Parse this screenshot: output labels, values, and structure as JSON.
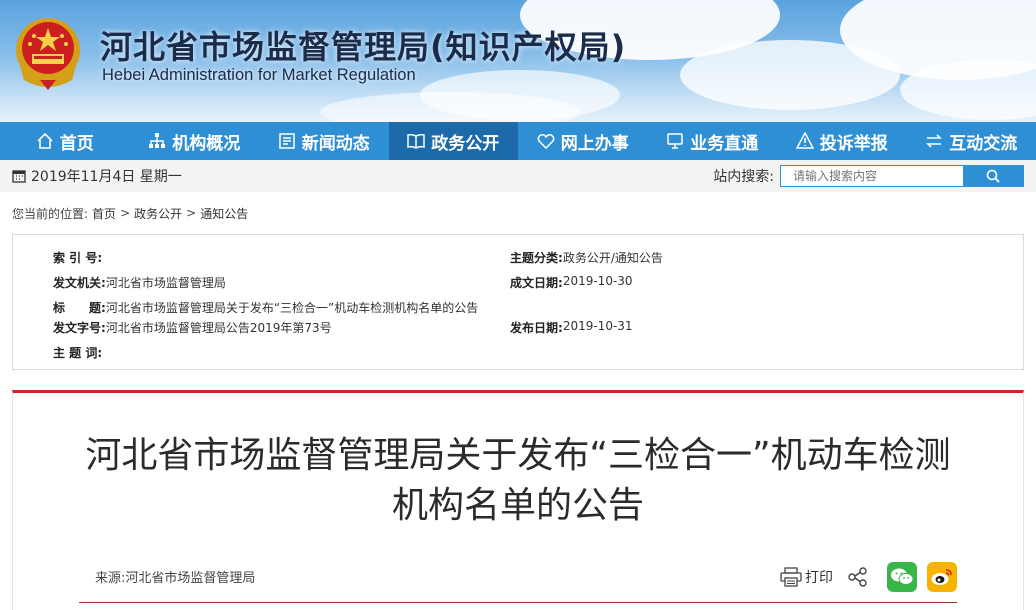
{
  "header": {
    "title": "河北省市场监督管理局(知识产权局)",
    "subtitle": "Hebei Administration for Market Regulation"
  },
  "nav": {
    "items": [
      {
        "label": "首页",
        "icon": "home-icon"
      },
      {
        "label": "机构概况",
        "icon": "org-chart-icon"
      },
      {
        "label": "新闻动态",
        "icon": "news-icon"
      },
      {
        "label": "政务公开",
        "icon": "open-book-icon",
        "active": true
      },
      {
        "label": "网上办事",
        "icon": "heart-icon"
      },
      {
        "label": "业务直通",
        "icon": "monitor-icon"
      },
      {
        "label": "投诉举报",
        "icon": "warning-icon"
      },
      {
        "label": "互动交流",
        "icon": "exchange-icon"
      }
    ]
  },
  "toolbar": {
    "date": "2019年11月4日 星期一",
    "search_label": "站内搜索:",
    "search_placeholder": "请输入搜索内容"
  },
  "breadcrumb": {
    "prefix": "您当前的位置:",
    "items": [
      "首页",
      "政务公开",
      "通知公告"
    ],
    "separator": ">"
  },
  "meta": {
    "index_label": "索 引 号:",
    "index_value": "",
    "category_label": "主题分类:",
    "category_value": "政务公开/通知公告",
    "issuer_label": "发文机关:",
    "issuer_value": "河北省市场监督管理局",
    "created_label": "成文日期:",
    "created_value": "2019-10-30",
    "title_label": "标　　题:",
    "title_value": "河北省市场监督管理局关于发布“三检合一”机动车检测机构名单的公告",
    "docno_label": "发文字号:",
    "docno_value": "河北省市场监督管理局公告2019年第73号",
    "published_label": "发布日期:",
    "published_value": "2019-10-31",
    "keywords_label": "主 题 词:",
    "keywords_value": ""
  },
  "article": {
    "title": "河北省市场监督管理局关于发布“三检合一”机动车检测机构名单的公告",
    "source": "来源:河北省市场监督管理局",
    "print_label": "打印"
  },
  "colors": {
    "nav_bg": "#2f8fd4",
    "nav_active": "#1c6aaa",
    "accent_red": "#d4242a",
    "wechat_green": "#3ab54a",
    "weibo_gold": "#f4b400"
  }
}
